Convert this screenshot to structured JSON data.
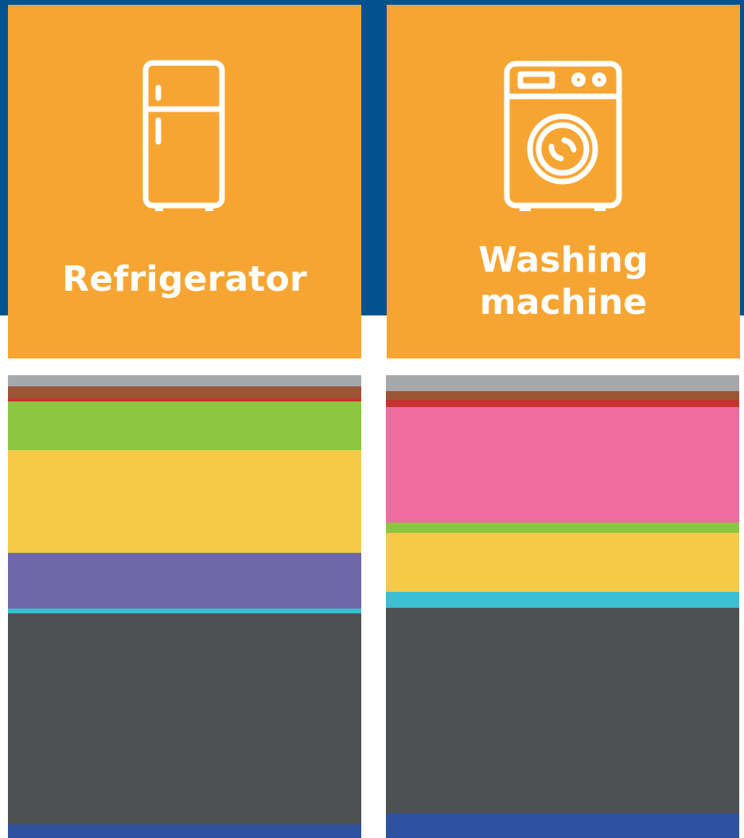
{
  "page": {
    "background_band_color": "#04518f",
    "card_color": "#f7a532",
    "icon_color": "#ffffff"
  },
  "cards": [
    {
      "label": "Refrigerator",
      "icon": "refrigerator-icon"
    },
    {
      "label": "Washing machine",
      "label_lines": [
        "Washing",
        "machine"
      ],
      "icon": "washing-machine-icon"
    }
  ],
  "chart_data": {
    "type": "bar",
    "stacked": true,
    "orientation": "vertical-stack",
    "categories": [
      "Refrigerator",
      "Washing machine"
    ],
    "unit": "share (%) of total",
    "total": 100,
    "series_colors": [
      "#a6a8ab",
      "#9b5537",
      "#c7312f",
      "#f06b9f",
      "#8cc540",
      "#f6ca47",
      "#6e68a9",
      "#3ac0d2",
      "#4e5152",
      "#2e52a0"
    ],
    "series": [
      {
        "color": "#a6a8ab",
        "values": [
          2.4,
          3.4
        ]
      },
      {
        "color": "#9b5537",
        "values": [
          2.6,
          1.9
        ]
      },
      {
        "color": "#c7312f",
        "values": [
          0.7,
          1.6
        ]
      },
      {
        "color": "#f06b9f",
        "values": [
          0,
          25.0
        ]
      },
      {
        "color": "#8cc540",
        "values": [
          10.5,
          2.2
        ]
      },
      {
        "color": "#f6ca47",
        "values": [
          22.2,
          12.8
        ]
      },
      {
        "color": "#6e68a9",
        "values": [
          12.1,
          0
        ]
      },
      {
        "color": "#3ac0d2",
        "values": [
          1.0,
          3.4
        ]
      },
      {
        "color": "#4e5152",
        "values": [
          45.8,
          44.5
        ]
      },
      {
        "color": "#2e52a0",
        "values": [
          2.7,
          5.2
        ]
      }
    ]
  }
}
